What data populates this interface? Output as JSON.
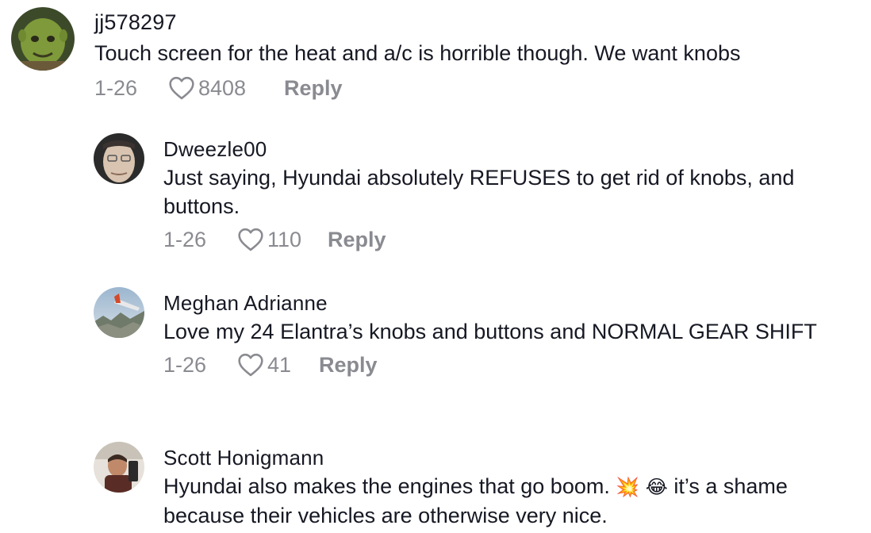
{
  "comments": [
    {
      "username": "jj578297",
      "text": "Touch screen for the heat and a/c is horrible though. We want knobs",
      "date": "1-26",
      "likes": "8408",
      "reply_label": "Reply"
    },
    {
      "username": "Dweezle00",
      "text": "Just saying, Hyundai absolutely REFUSES to get rid of knobs, and buttons.",
      "date": "1-26",
      "likes": "110",
      "reply_label": "Reply"
    },
    {
      "username": "Meghan Adrianne",
      "text": "Love my 24 Elantra’s knobs and buttons and NORMAL GEAR SHIFT",
      "date": "1-26",
      "likes": "41",
      "reply_label": "Reply"
    },
    {
      "username": "Scott Honigmann",
      "text_part1": "Hyundai also makes the engines that go boom. ",
      "emoji1": "💥",
      "emoji2": "😂",
      "text_part2": " it’s a shame because their vehicles are otherwise very nice."
    }
  ],
  "colors": {
    "text": "#161823",
    "meta": "#8a8b91",
    "background": "#ffffff"
  },
  "icons": {
    "like": "heart-outline-icon"
  }
}
